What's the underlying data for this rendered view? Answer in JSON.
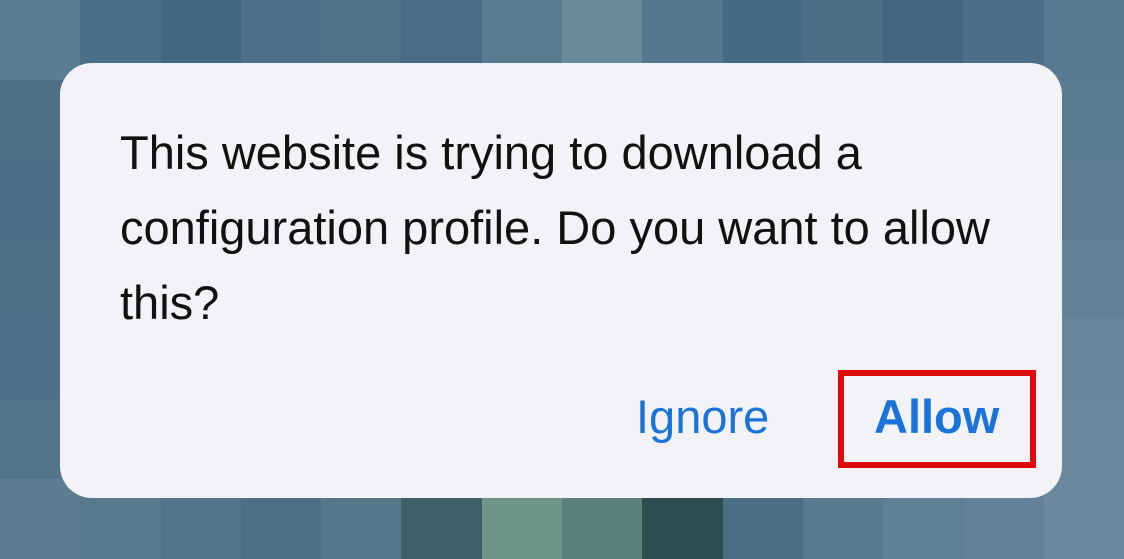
{
  "dialog": {
    "message": "This website is trying to download a configuration profile. Do you want to allow this?",
    "buttons": {
      "ignore_label": "Ignore",
      "allow_label": "Allow"
    }
  },
  "colors": {
    "dialog_background": "#f2f2f7",
    "button_text": "#1a73d9",
    "highlight_border": "#e00b0b",
    "backdrop": "#4a6b82"
  }
}
